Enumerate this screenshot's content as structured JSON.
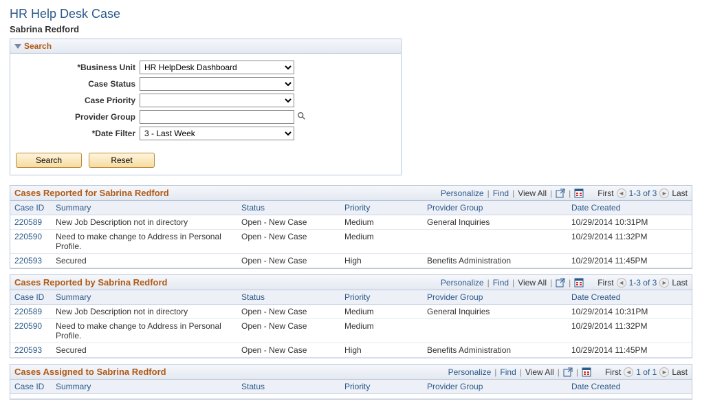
{
  "page": {
    "title": "HR Help Desk Case",
    "subtitle": "Sabrina Redford"
  },
  "search": {
    "header": "Search",
    "fields": {
      "business_unit": {
        "label": "*Business Unit",
        "value": "HR HelpDesk Dashboard"
      },
      "case_status": {
        "label": "Case Status",
        "value": ""
      },
      "case_priority": {
        "label": "Case Priority",
        "value": ""
      },
      "provider_group": {
        "label": "Provider Group",
        "value": ""
      },
      "date_filter": {
        "label": "*Date Filter",
        "value": "3 - Last Week"
      }
    },
    "buttons": {
      "search": "Search",
      "reset": "Reset"
    }
  },
  "toolbar": {
    "personalize": "Personalize",
    "find": "Find",
    "view_all": "View All",
    "first": "First",
    "last": "Last"
  },
  "columns": {
    "case_id": "Case ID",
    "summary": "Summary",
    "status": "Status",
    "priority": "Priority",
    "provider_group": "Provider Group",
    "date_created": "Date Created"
  },
  "grids": [
    {
      "title": "Cases Reported for Sabrina Redford",
      "range": "1-3 of 3",
      "rows": [
        {
          "case_id": "220589",
          "summary": "New Job Description not in directory",
          "status": "Open - New Case",
          "priority": "Medium",
          "provider_group": "General Inquiries",
          "date_created": "10/29/2014 10:31PM"
        },
        {
          "case_id": "220590",
          "summary": "Need to make change to Address in Personal Profile.",
          "status": "Open - New Case",
          "priority": "Medium",
          "provider_group": "",
          "date_created": "10/29/2014 11:32PM"
        },
        {
          "case_id": "220593",
          "summary": "Secured",
          "status": "Open - New Case",
          "priority": "High",
          "provider_group": "Benefits Administration",
          "date_created": "10/29/2014 11:45PM"
        }
      ]
    },
    {
      "title": "Cases Reported by Sabrina Redford",
      "range": "1-3 of 3",
      "rows": [
        {
          "case_id": "220589",
          "summary": "New Job Description not in directory",
          "status": "Open - New Case",
          "priority": "Medium",
          "provider_group": "General Inquiries",
          "date_created": "10/29/2014 10:31PM"
        },
        {
          "case_id": "220590",
          "summary": "Need to make change to Address in Personal Profile.",
          "status": "Open - New Case",
          "priority": "Medium",
          "provider_group": "",
          "date_created": "10/29/2014 11:32PM"
        },
        {
          "case_id": "220593",
          "summary": "Secured",
          "status": "Open - New Case",
          "priority": "High",
          "provider_group": "Benefits Administration",
          "date_created": "10/29/2014 11:45PM"
        }
      ]
    },
    {
      "title": "Cases Assigned to Sabrina Redford",
      "range": "1 of 1",
      "rows": [
        {
          "case_id": "",
          "summary": "",
          "status": "",
          "priority": "",
          "provider_group": "",
          "date_created": ""
        }
      ]
    }
  ]
}
